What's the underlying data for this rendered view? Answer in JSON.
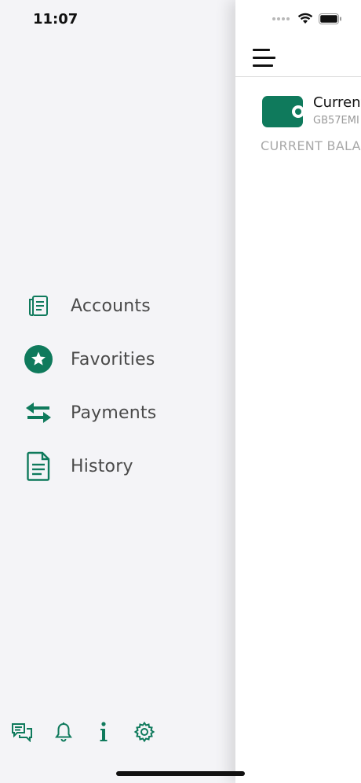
{
  "status_bar": {
    "time": "11:07"
  },
  "drawer": {
    "menu": [
      {
        "label": "Accounts",
        "icon": "accounts-icon"
      },
      {
        "label": "Favorities",
        "icon": "star-icon"
      },
      {
        "label": "Payments",
        "icon": "transfer-arrows-icon"
      },
      {
        "label": "History",
        "icon": "document-icon"
      }
    ],
    "bottom_icons": [
      "chat-icon",
      "bell-icon",
      "info-icon",
      "gear-icon"
    ]
  },
  "main": {
    "account": {
      "name": "Current",
      "iban": "GB57EMI",
      "icon": "wallet-icon"
    },
    "balance_label": "CURRENT BALA"
  },
  "colors": {
    "accent": "#0f7a5c",
    "drawer_bg": "#f4f4f7",
    "text": "#4a4a4a",
    "muted": "#a8a8a8"
  }
}
